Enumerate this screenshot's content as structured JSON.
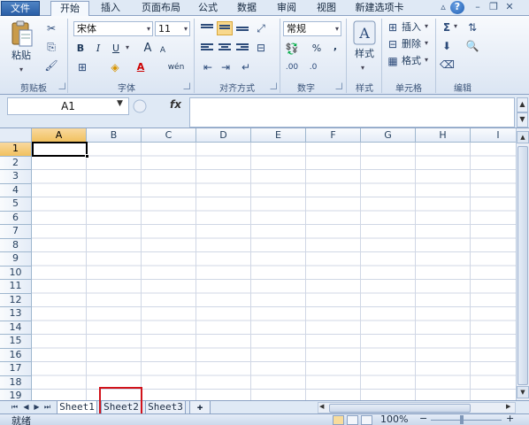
{
  "menu": {
    "file": "文件",
    "tabs": [
      "开始",
      "插入",
      "页面布局",
      "公式",
      "数据",
      "审阅",
      "视图",
      "新建选项卡"
    ]
  },
  "ribbon": {
    "clipboard": {
      "label": "剪贴板",
      "paste": "粘贴"
    },
    "font": {
      "label": "字体",
      "name": "宋体",
      "size": "11",
      "bold": "B",
      "italic": "I",
      "underline": "U",
      "grow": "A",
      "shrink": "A",
      "wen": "wén",
      "fontcolor": "A"
    },
    "alignment": {
      "label": "对齐方式"
    },
    "number": {
      "label": "数字",
      "format": "常规",
      "percent": "%",
      "comma": ","
    },
    "styles": {
      "label": "样式",
      "button": "样式"
    },
    "cells": {
      "label": "单元格",
      "insert": "插入",
      "delete": "删除",
      "format": "格式"
    },
    "editing": {
      "label": "编辑"
    }
  },
  "formula_bar": {
    "name_box": "A1",
    "fx": "fx",
    "value": ""
  },
  "grid": {
    "columns": [
      "A",
      "B",
      "C",
      "D",
      "E",
      "F",
      "G",
      "H",
      "I"
    ],
    "rows": [
      "1",
      "2",
      "3",
      "4",
      "5",
      "6",
      "7",
      "8",
      "9",
      "10",
      "11",
      "12",
      "13",
      "14",
      "15",
      "16",
      "17",
      "18",
      "19"
    ],
    "selected_cell": "A1"
  },
  "sheets": {
    "tabs": [
      "Sheet1",
      "Sheet2",
      "Sheet3"
    ],
    "active": "Sheet1",
    "highlighted": "Sheet2"
  },
  "status": {
    "text": "就绪",
    "zoom": "100%"
  },
  "colors": {
    "ribbon_bg": "#dbe5f3",
    "accent": "#2a5ea6",
    "highlight": "#d1131b",
    "selected_header": "#f1c15f"
  }
}
